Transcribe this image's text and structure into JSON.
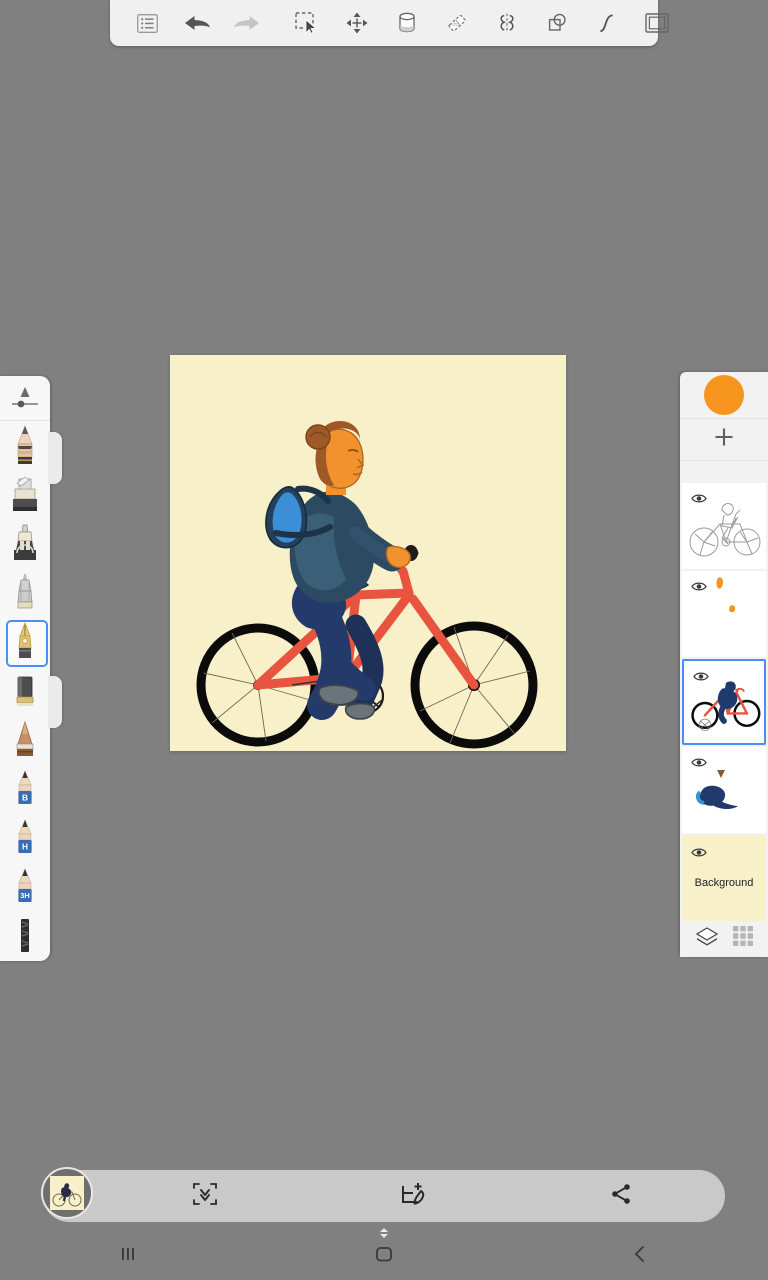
{
  "app": {
    "background_color": "#808080",
    "canvas_color": "#f7f0c8",
    "accent_color": "#4c8ef7",
    "active_swatch_color": "#f7941e"
  },
  "top_toolbar": {
    "groups": [
      {
        "name": "history",
        "buttons": [
          {
            "icon": "layers-list-icon",
            "label": "Layers list"
          },
          {
            "icon": "undo-arrow-icon",
            "label": "Undo"
          },
          {
            "icon": "redo-arrow-icon",
            "label": "Redo"
          }
        ]
      },
      {
        "name": "edit-tools",
        "buttons": [
          {
            "icon": "marquee-select-icon",
            "label": "Select"
          },
          {
            "icon": "move-arrows-icon",
            "label": "Transform"
          },
          {
            "icon": "paint-bucket-icon",
            "label": "Fill"
          },
          {
            "icon": "eraser-icon",
            "label": "Eraser"
          },
          {
            "icon": "symmetry-mirror-icon",
            "label": "Symmetry"
          },
          {
            "icon": "shapes-overlap-icon",
            "label": "Shapes"
          },
          {
            "icon": "curve-stroke-icon",
            "label": "Curve"
          }
        ]
      },
      {
        "name": "canvas-tools",
        "buttons": [
          {
            "icon": "canvas-frame-icon",
            "label": "Canvas"
          }
        ]
      }
    ]
  },
  "brush_panel": {
    "slider": {
      "icon": "brush-size-slider-icon",
      "label": "Brush size"
    },
    "tools": [
      {
        "icon": "pencil-tool-icon",
        "label": "Pencil",
        "selected": false
      },
      {
        "icon": "marker-tool-icon",
        "label": "Marker",
        "selected": false
      },
      {
        "icon": "airbrush-tool-icon",
        "label": "Airbrush",
        "selected": false
      },
      {
        "icon": "ink-pen-tool-icon",
        "label": "Ink pen",
        "selected": false
      },
      {
        "icon": "fountain-pen-tool-icon",
        "label": "Fountain pen",
        "selected": true
      },
      {
        "icon": "eraser-block-tool-icon",
        "label": "Eraser block",
        "selected": false
      },
      {
        "icon": "flat-brush-tool-icon",
        "label": "Flat brush",
        "selected": false
      },
      {
        "icon": "pencil-b-tool-icon",
        "label": "B pencil",
        "grade": "B",
        "selected": false
      },
      {
        "icon": "pencil-h-tool-icon",
        "label": "H pencil",
        "grade": "H",
        "selected": false
      },
      {
        "icon": "pencil-3h-tool-icon",
        "label": "3H pencil",
        "grade": "3H",
        "selected": false
      },
      {
        "icon": "charcoal-tool-icon",
        "label": "Charcoal",
        "selected": false
      }
    ]
  },
  "layers_panel": {
    "color_swatch": {
      "name": "color-swatch",
      "color": "#f7941e"
    },
    "add_button": {
      "icon": "plus-icon",
      "label": "Add layer"
    },
    "layers": [
      {
        "name": "sketch-layer",
        "thumb": "bicycle-sketch",
        "visible": true,
        "selected": false,
        "label": ""
      },
      {
        "name": "highlights-layer",
        "thumb": "orange-marks",
        "visible": true,
        "selected": false,
        "label": ""
      },
      {
        "name": "color-layer",
        "thumb": "bicycle-color",
        "visible": true,
        "selected": true,
        "label": ""
      },
      {
        "name": "detail-layer",
        "thumb": "figure-detail",
        "visible": true,
        "selected": false,
        "label": ""
      },
      {
        "name": "background-layer",
        "thumb": "background-fill",
        "visible": true,
        "selected": false,
        "label": "Background"
      }
    ],
    "footer": [
      {
        "icon": "layers-stack-icon",
        "label": "Layers"
      },
      {
        "icon": "grid-view-icon",
        "label": "Grid"
      }
    ]
  },
  "bottom_bar": {
    "thumbnail": {
      "name": "artwork-thumbnail",
      "label": "Current artwork"
    },
    "buttons": [
      {
        "icon": "fit-screen-icon",
        "label": "Fit to screen"
      },
      {
        "icon": "add-drawing-icon",
        "label": "New drawing"
      },
      {
        "icon": "share-icon",
        "label": "Share"
      }
    ],
    "handle": {
      "icon": "drag-handle-icon",
      "label": "Expand bar"
    }
  },
  "nav_bar": {
    "buttons": [
      {
        "icon": "recents-icon",
        "label": "Recents"
      },
      {
        "icon": "home-icon",
        "label": "Home"
      },
      {
        "icon": "back-icon",
        "label": "Back"
      }
    ]
  },
  "artwork": {
    "title": "Woman riding a bicycle",
    "palette": {
      "background": "#f7f0c8",
      "skin": "#f2922e",
      "hair": "#9d5a27",
      "jacket": "#2d4a63",
      "jacket_shade": "#3c5f78",
      "pants": "#243a6b",
      "bag_light": "#3a8fd6",
      "bag_dark": "#24405c",
      "bike": "#e8543f",
      "shoes": "#6b737b",
      "tires": "#000000"
    }
  }
}
